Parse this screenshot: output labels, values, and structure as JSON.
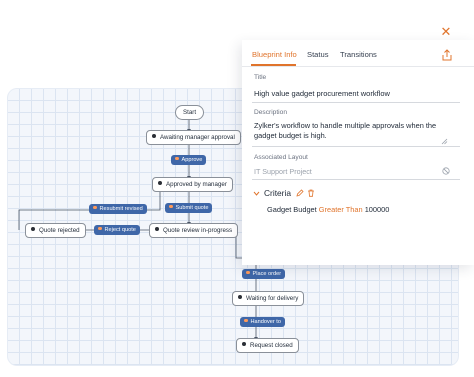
{
  "panel": {
    "tabs": [
      {
        "label": "Blueprint Info",
        "active": true
      },
      {
        "label": "Status",
        "active": false
      },
      {
        "label": "Transitions",
        "active": false
      }
    ],
    "title_label": "Title",
    "title_value": "High value gadget procurement workflow",
    "description_label": "Description",
    "description_value": "Zylker's workflow to handle multiple approvals when the gadget budget is high.",
    "layout_label": "Associated Layout",
    "layout_value": "IT Support Project",
    "criteria": {
      "title": "Criteria",
      "field": "Gadget Budget",
      "operator": "Greater Than",
      "value": "100000"
    }
  },
  "flow": {
    "start": "Start",
    "awaiting": "Awaiting manager approval",
    "approve": "Approve",
    "approved": "Approved by manager",
    "resubmit": "Resubmit revised",
    "submit_quote": "Submit quote",
    "quote_rejected": "Quote rejected",
    "reject_quote": "Reject quote",
    "quote_review": "Quote review in-progress",
    "place_order": "Place order",
    "waiting_delivery": "Waiting for delivery",
    "handover": "Handover to",
    "request_closed": "Request closed"
  },
  "colors": {
    "accent": "#e0742c",
    "transition_pill": "#3f67a8",
    "grid_bg": "#f3f6fb"
  },
  "icons": {
    "close": "close-icon",
    "share": "share-icon",
    "edit": "edit-icon",
    "delete": "trash-icon",
    "collapse": "chevron-down-icon",
    "cleared": "ban-icon",
    "resize": "resize-handle-icon"
  }
}
